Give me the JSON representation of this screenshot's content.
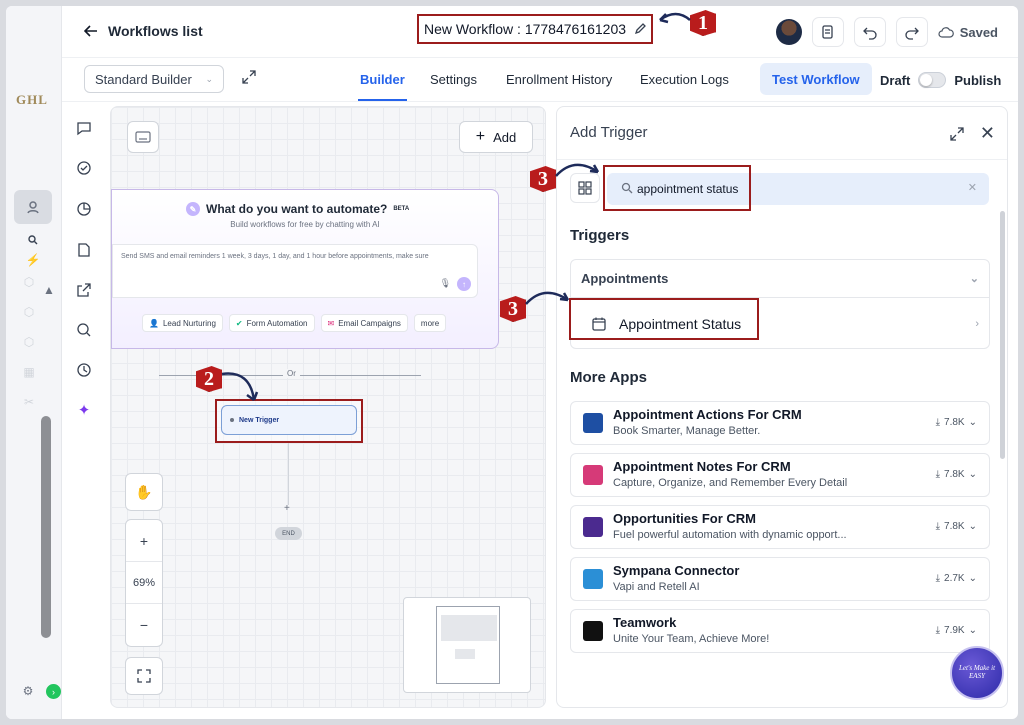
{
  "header": {
    "back_label": "Workflows list",
    "workflow_title": "New Workflow : 1778476161203",
    "saved_label": "Saved"
  },
  "brand": {
    "logo_text": "GHL"
  },
  "tabsbar": {
    "builder_mode": "Standard Builder",
    "tabs": [
      {
        "label": "Builder",
        "active": true
      },
      {
        "label": "Settings",
        "active": false
      },
      {
        "label": "Enrollment History",
        "active": false
      },
      {
        "label": "Execution Logs",
        "active": false
      }
    ],
    "test_workflow": "Test Workflow",
    "draft_label": "Draft",
    "publish_label": "Publish"
  },
  "canvas": {
    "add_label": "Add",
    "ai_title": "What do you want to automate?",
    "ai_beta": "BETA",
    "ai_subtitle": "Build workflows for free by chatting with AI",
    "ai_placeholder": "Send SMS and email reminders 1 week, 3 days, 1 day, and 1 hour before appointments, make sure",
    "chips": [
      "Lead Nurturing",
      "Form Automation",
      "Email Campaigns",
      "more"
    ],
    "or_label": "Or",
    "trigger_label": "New Trigger",
    "end_label": "END",
    "zoom": "69%"
  },
  "panel": {
    "title": "Add Trigger",
    "search_value": "appointment status",
    "triggers_heading": "Triggers",
    "category": "Appointments",
    "trigger_item": "Appointment Status",
    "more_apps_heading": "More Apps",
    "apps": [
      {
        "name": "Appointment Actions For CRM",
        "desc": "Book Smarter, Manage Better.",
        "downloads": "7.8K",
        "color": "#1e4fa3"
      },
      {
        "name": "Appointment Notes For CRM",
        "desc": "Capture, Organize, and Remember Every Detail",
        "downloads": "7.8K",
        "color": "#d63a78"
      },
      {
        "name": "Opportunities For CRM",
        "desc": "Fuel powerful automation with dynamic opport...",
        "downloads": "7.8K",
        "color": "#4b2a8f"
      },
      {
        "name": "Sympana Connector",
        "desc": "Vapi and Retell AI",
        "downloads": "2.7K",
        "color": "#2b8fd6"
      },
      {
        "name": "Teamwork",
        "desc": "Unite Your Team, Achieve More!",
        "downloads": "7.9K",
        "color": "#111111"
      }
    ]
  },
  "annotations": {
    "badge1": "1",
    "badge2": "2",
    "badge3a": "3",
    "badge3b": "3",
    "watermark": "Let's Make it EASY"
  },
  "colors": {
    "accent": "#2563eb",
    "highlight_box": "#9b1c1c",
    "badge": "#b91c1c"
  }
}
